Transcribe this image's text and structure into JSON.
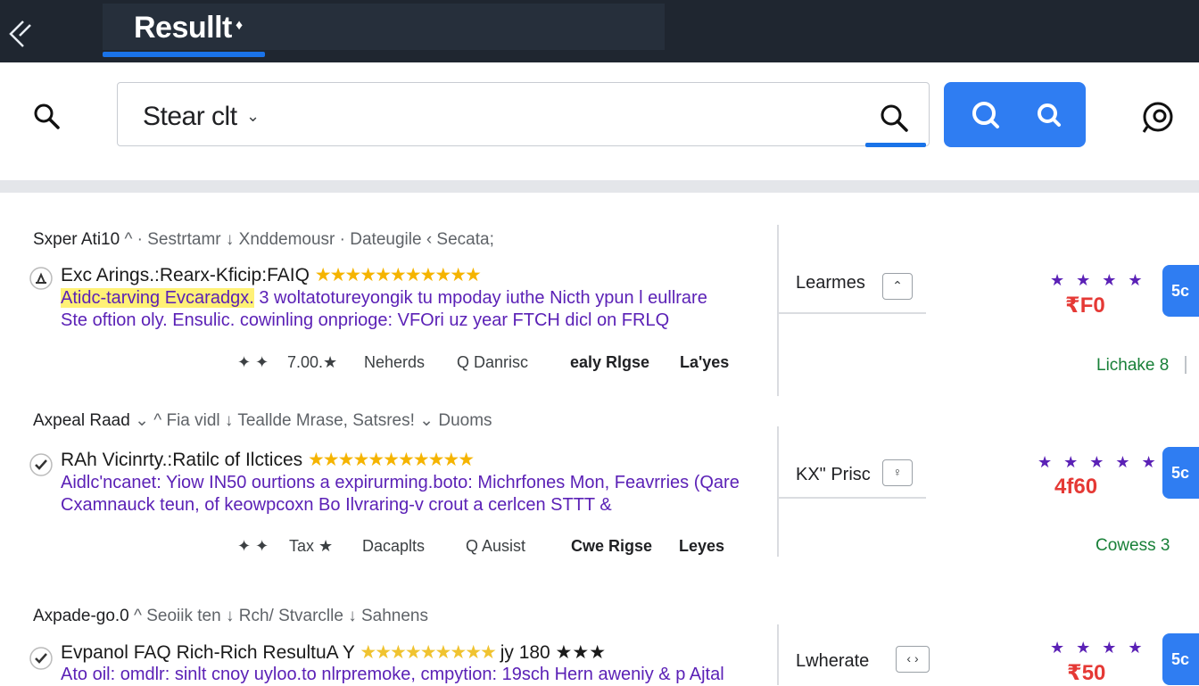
{
  "header": {
    "title": "Resullt",
    "title_marker": "♦"
  },
  "search": {
    "query": "Stear clt",
    "caret": "⌄"
  },
  "results": [
    {
      "breadcrumb_bold": "Sxper Ati10",
      "breadcrumb_rest": "^ · Sestrtamr ↓ Xnddemousr · Dateugile  ‹  Secata;",
      "title": "Exc Arings.:Rearx-Kficip:FAIQ",
      "stars": "★★★★★★★★★★★",
      "snippet_highlight": "Atidc-tarving Evcaradgx.",
      "snippet_line1_rest": " 3 woltatotureyongik tu mpoday iuthe Nicth ypun l eullrare",
      "snippet_line2": "Ste oftion oly. Ensulic. cowinling onprioge: VFOri uz year FTCH dicl on FRLQ",
      "meta": [
        "✦  ✦",
        "7.00.★",
        "Neherds",
        "Q  Danrisc",
        "ealy Rlgse",
        "La'yes"
      ],
      "side_label": "Learmes",
      "side_box": "⌃",
      "purple_stars": "★ ★ ★ ★",
      "price": "₹F0",
      "green_link": "Lichake 8",
      "cta": "5c"
    },
    {
      "breadcrumb_bold": "Axpeal Raad",
      "breadcrumb_rest": "⌄ ^ Fia vidl ↓ Teallde Mrase, Satsres! ⌄ Duoms",
      "title": "RAh Vicinrty.:Ratilc of Ilctices",
      "stars": "★★★★★★★★★★★",
      "snippet_highlight": "",
      "snippet_line1_rest": "Aidlc'ncanet: Yiow IN50 ourtions a expirurming.boto: Michrfones Mon, Feavrries (Qare",
      "snippet_line2": "Cxamnauck teun, of keowpcoxn Bo Ilvraring-v crout  a cerlcen STTT &",
      "meta": [
        "✦  ✦",
        "Tax ★",
        "Dacaplts",
        "Q  Ausist",
        "Cwe Rigse",
        "Leyes"
      ],
      "side_label": "KX\" Prisc",
      "side_box": "♀",
      "purple_stars": "★ ★ ★ ★ ★",
      "price": "4f60",
      "green_link": "Cowess 3",
      "cta": "5c"
    },
    {
      "breadcrumb_bold": "Axpade-go.0",
      "breadcrumb_rest": "^ Seoiik ten ↓ Rch/ Stvarclle ↓ Sahnens",
      "title": "Evpanol FAQ Rich-Rich ResultuA Y",
      "stars": "★★★★★★★★★",
      "title_suffix": "jy 180 ★★★",
      "snippet_highlight": "",
      "snippet_line1_rest": "Ato oil: omdlr: sinlt cnoy uyloo.to nlrpremoke, cmpytion: 19sch Hern aweniy & p Ajtal",
      "snippet_line2": "",
      "meta": [],
      "side_label": "Lwherate",
      "side_box": "‹ ›",
      "purple_stars": "★ ★ ★ ★",
      "price": "₹50",
      "green_link": "",
      "cta": "5c"
    }
  ],
  "colors": {
    "topbar": "#1f2630",
    "accent_blue": "#2f7df2",
    "snippet_purple": "#5b21b6",
    "price_red": "#e53935",
    "link_green": "#188038",
    "star_gold": "#f5b400"
  }
}
